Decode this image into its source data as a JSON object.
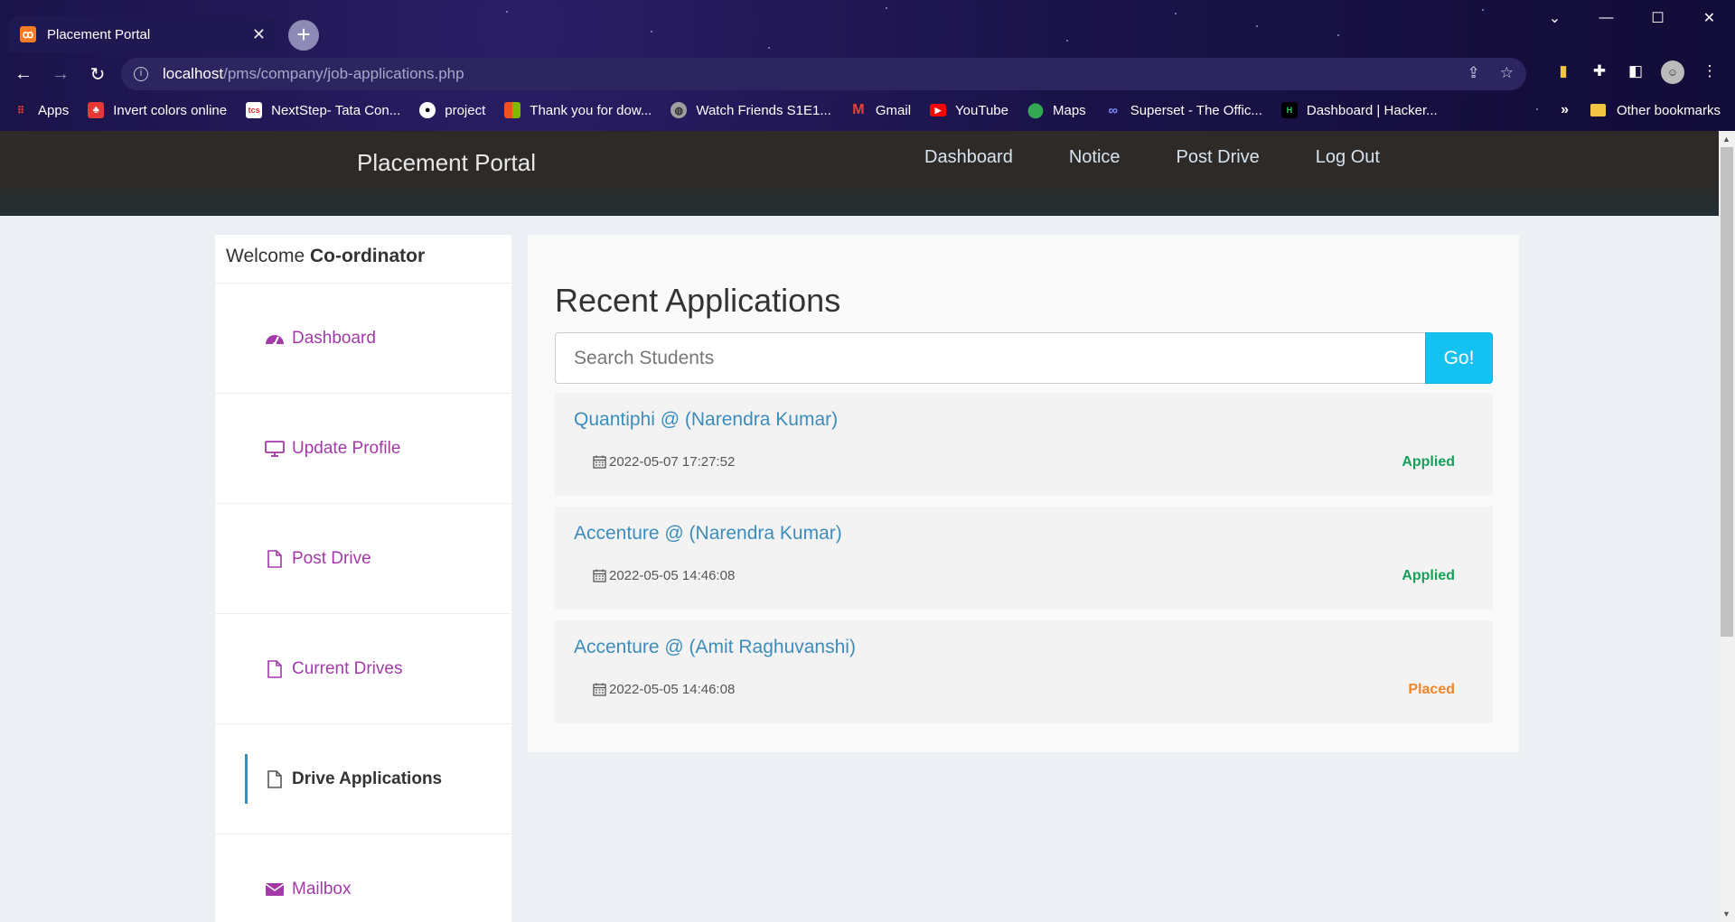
{
  "browser": {
    "tab_title": "Placement Portal",
    "tab_close": "✕",
    "new_tab": "+",
    "url_host": "localhost",
    "url_path": "/pms/company/job-applications.php",
    "bookmarks": [
      {
        "label": "Apps",
        "icon": "apps-grid-icon",
        "color": "#e94335"
      },
      {
        "label": "Invert colors online",
        "icon": "tree-icon",
        "color": "#e53935"
      },
      {
        "label": "NextStep- Tata Con...",
        "icon": "tcs-icon",
        "color": "#d32f2f"
      },
      {
        "label": "project",
        "icon": "github-icon",
        "color": "#ffffff"
      },
      {
        "label": "Thank you for dow...",
        "icon": "windows-icon",
        "color": "#4caf50"
      },
      {
        "label": "Watch Friends S1E1...",
        "icon": "globe-icon",
        "color": "#9e9e9e"
      },
      {
        "label": "Gmail",
        "icon": "gmail-icon",
        "color": "#ea4335"
      },
      {
        "label": "YouTube",
        "icon": "youtube-icon",
        "color": "#ff0000"
      },
      {
        "label": "Maps",
        "icon": "maps-icon",
        "color": "#34a853"
      },
      {
        "label": "Superset - The Offic...",
        "icon": "superset-icon",
        "color": "#7c8cff"
      },
      {
        "label": "Dashboard | Hacker...",
        "icon": "hackerrank-icon",
        "color": "#2ec866"
      }
    ],
    "bookmarks_more": "»",
    "other_bookmarks": "Other bookmarks"
  },
  "header": {
    "brand": "Placement Portal",
    "nav": [
      "Dashboard",
      "Notice",
      "Post Drive",
      "Log Out"
    ]
  },
  "sidebar": {
    "welcome_prefix": "Welcome",
    "welcome_name": "Co-ordinator",
    "items": [
      {
        "label": "Dashboard",
        "icon": "dashboard-gauge-icon"
      },
      {
        "label": "Update Profile",
        "icon": "monitor-icon"
      },
      {
        "label": "Post Drive",
        "icon": "file-icon"
      },
      {
        "label": "Current Drives",
        "icon": "file-icon"
      },
      {
        "label": "Drive Applications",
        "icon": "file-icon",
        "active": true
      },
      {
        "label": "Mailbox",
        "icon": "envelope-icon"
      }
    ]
  },
  "main": {
    "heading": "Recent Applications",
    "search_placeholder": "Search Students",
    "search_button": "Go!",
    "applications": [
      {
        "title": "Quantiphi @ (Narendra Kumar)",
        "date": "2022-05-07 17:27:52",
        "status": "Applied",
        "status_color": "#16a05a"
      },
      {
        "title": "Accenture @ (Narendra Kumar)",
        "date": "2022-05-05 14:46:08",
        "status": "Applied",
        "status_color": "#16a05a"
      },
      {
        "title": "Accenture @ (Amit Raghuvanshi)",
        "date": "2022-05-05 14:46:08",
        "status": "Placed",
        "status_color": "#f0862a"
      }
    ]
  },
  "colors": {
    "sidebar_link": "#a23aa8",
    "accent_blue": "#3c8dbc",
    "button_cyan": "#14c2f2"
  }
}
